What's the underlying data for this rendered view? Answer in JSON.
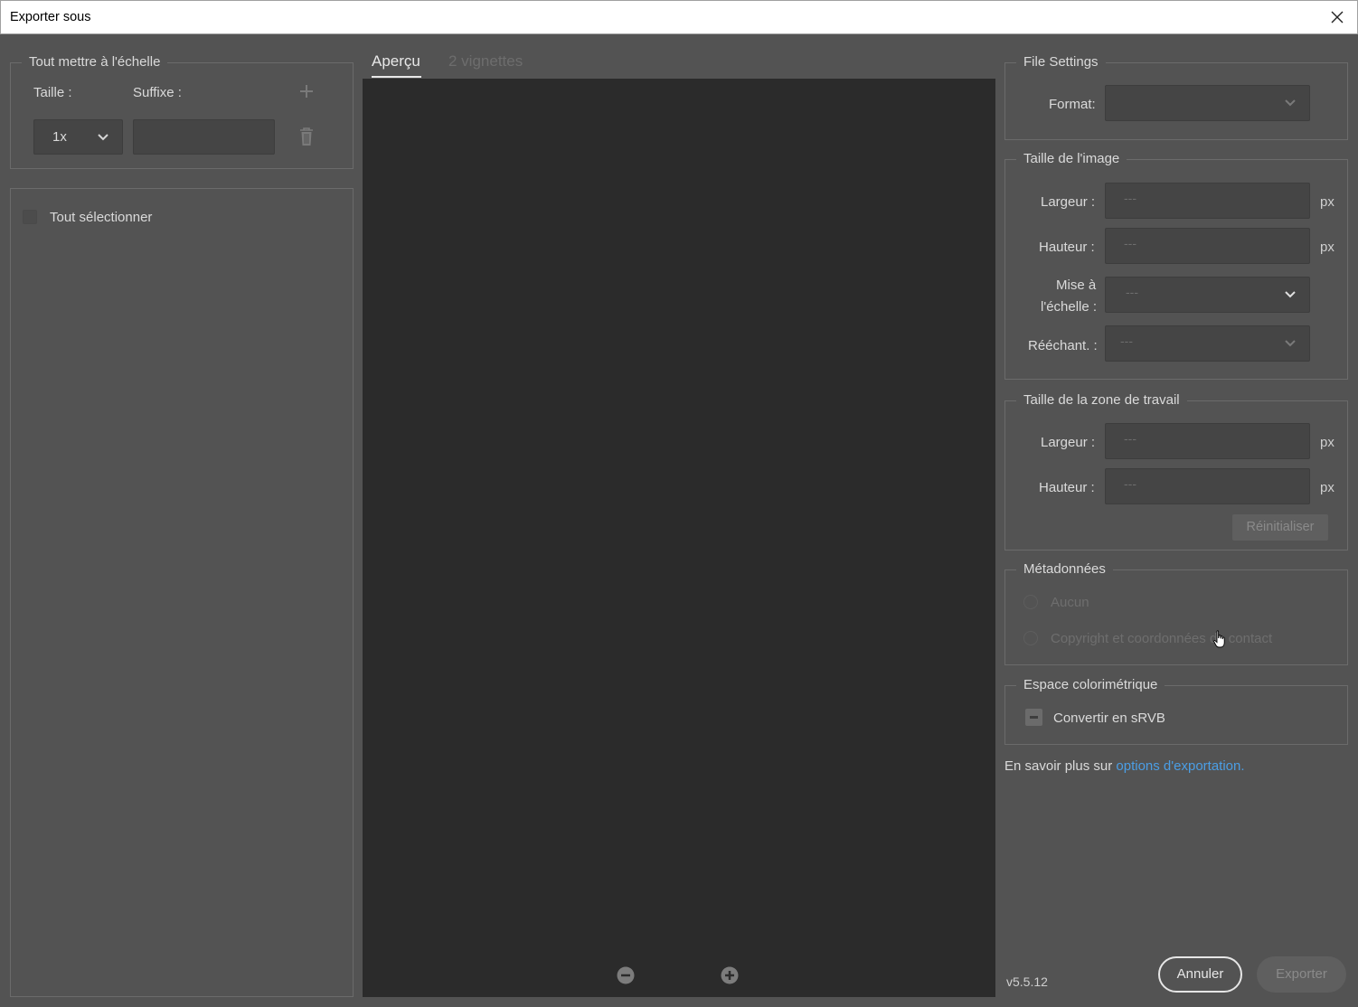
{
  "window": {
    "title": "Exporter sous"
  },
  "scale_panel": {
    "legend": "Tout mettre à l'échelle",
    "size_label": "Taille :",
    "suffix_label": "Suffixe :",
    "size_value": "1x",
    "suffix_value": ""
  },
  "select_panel": {
    "select_all_label": "Tout sélectionner"
  },
  "tabs": {
    "preview": "Aperçu",
    "thumbnails": "2 vignettes"
  },
  "file_settings": {
    "legend": "File Settings",
    "format_label": "Format:",
    "format_value": ""
  },
  "image_size": {
    "legend": "Taille de l'image",
    "width_label": "Largeur :",
    "height_label": "Hauteur :",
    "scale_label_1": "Mise à",
    "scale_label_2": "l'échelle :",
    "resample_label": "Rééchant. :",
    "width_placeholder": "---",
    "height_placeholder": "---",
    "scale_value": "---",
    "resample_value": "---",
    "unit": "px"
  },
  "canvas_size": {
    "legend": "Taille de la zone de travail",
    "width_label": "Largeur :",
    "height_label": "Hauteur :",
    "width_placeholder": "---",
    "height_placeholder": "---",
    "unit": "px",
    "reset_label": "Réinitialiser"
  },
  "metadata": {
    "legend": "Métadonnées",
    "option_none": "Aucun",
    "option_copyright": "Copyright et coordonnées de contact"
  },
  "color_space": {
    "legend": "Espace colorimétrique",
    "convert_label": "Convertir en sRVB"
  },
  "learn_more": {
    "prefix": "En savoir plus sur ",
    "link": "options d'exportation."
  },
  "footer": {
    "version": "v5.5.12",
    "cancel": "Annuler",
    "export": "Exporter"
  },
  "icons": [
    "close-icon",
    "plus-icon",
    "trash-icon",
    "chevron-down-icon",
    "zoom-out-icon",
    "zoom-in-icon",
    "hand-cursor-icon"
  ]
}
